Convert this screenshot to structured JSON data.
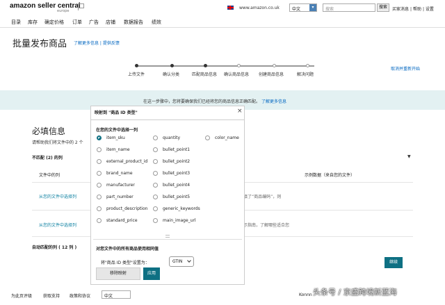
{
  "header": {
    "logo": "amazon seller central",
    "logo_sub": "europe",
    "site": "www.amazon.co.uk",
    "language": "中文",
    "search_placeholder": "搜索",
    "search_button": "搜索",
    "links": [
      "买家消息",
      "帮助",
      "设置"
    ]
  },
  "nav": [
    "目录",
    "库存",
    "确定价格",
    "订单",
    "广告",
    "店铺",
    "数据报告",
    "绩效"
  ],
  "page": {
    "title": "批量发布商品",
    "links": "了解更多信息 | 提供反馈",
    "cancel": "取消并重新开始"
  },
  "steps": [
    "上传文件",
    "确认分类",
    "匹配商品信息",
    "确认商品信息",
    "创建商品信息",
    "解决问题"
  ],
  "notice": {
    "text": "在这一步骤中，您将要确保我们已经将您的商品信息正确匹配。",
    "link": "了解更多信息"
  },
  "required": {
    "title": "必填信息",
    "desc": "请帮助我们将文件中的 2 个",
    "unmatched": "不匹配 (2) 的列",
    "col_file": "文件中的列",
    "col_sample": "示例数据（来自您的文件）",
    "row_link": "从您的文件中选择列",
    "row1_tail": "填了“商品编码”，则",
    "row2_tail": "示指南，了解哪些适合您",
    "auto": "自动匹配的列 ( 12 列 )",
    "continue": "继续"
  },
  "modal": {
    "title": "映射到 \"商品 ID 类型\"",
    "section": "在您的文件中选择一列",
    "options_col1": [
      "item_sku",
      "item_name",
      "external_product_id",
      "brand_name",
      "manufacturer",
      "part_number",
      "product_description",
      "standard_price"
    ],
    "options_col2": [
      "quantity",
      "bullet_point1",
      "bullet_point2",
      "bullet_point3",
      "bullet_point4",
      "bullet_point5",
      "generic_keywords",
      "main_image_url"
    ],
    "options_col3": [
      "color_name"
    ],
    "same_value": "对您文件中的所有商品使用相同值",
    "set_as": "将\"商品 ID 类型\"设置为：",
    "gtin": "GTIN",
    "remove": "移除映射",
    "apply": "应用"
  },
  "footer": {
    "items": [
      "为此页评级",
      "获取支持",
      "政策和协议"
    ],
    "language": "中文",
    "copy": "Konnn",
    "watermark": "头条号 / 京盛跨境新蓝海"
  }
}
